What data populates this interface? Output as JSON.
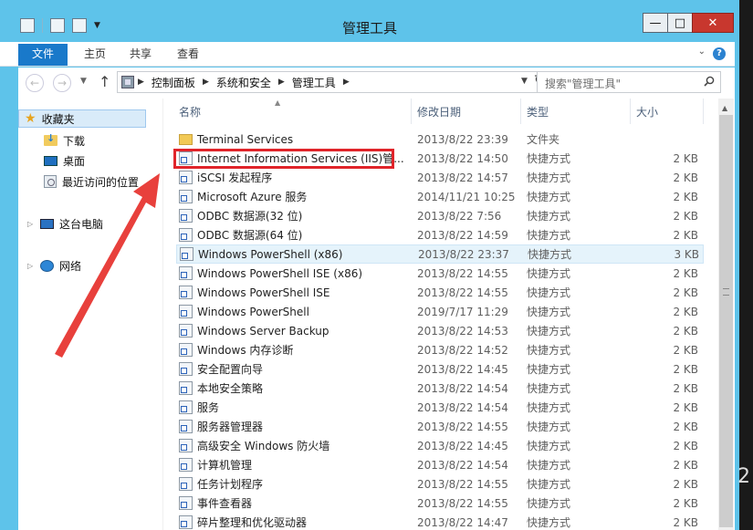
{
  "window": {
    "title": "管理工具",
    "controls": {
      "minimize": "—",
      "maximize": "□",
      "close": "✕"
    }
  },
  "ribbon": {
    "tabs": [
      "文件",
      "主页",
      "共享",
      "查看"
    ],
    "help": "?"
  },
  "navbar": {
    "breadcrumbs": [
      "控制面板",
      "系统和安全",
      "管理工具"
    ],
    "search_placeholder": "搜索\"管理工具\""
  },
  "sidebar": {
    "favorites_label": "收藏夹",
    "favorites": [
      "下载",
      "桌面",
      "最近访问的位置"
    ],
    "this_pc": "这台电脑",
    "network": "网络"
  },
  "filelist": {
    "columns": {
      "name": "名称",
      "date": "修改日期",
      "type": "类型",
      "size": "大小"
    },
    "rows": [
      {
        "name": "Terminal Services",
        "date": "2013/8/22 23:39",
        "type": "文件夹",
        "size": "",
        "kind": "folder"
      },
      {
        "name": "Internet Information Services (IIS)管...",
        "date": "2013/8/22 14:50",
        "type": "快捷方式",
        "size": "2 KB",
        "kind": "shortcut"
      },
      {
        "name": "iSCSI 发起程序",
        "date": "2013/8/22 14:57",
        "type": "快捷方式",
        "size": "2 KB",
        "kind": "shortcut"
      },
      {
        "name": "Microsoft Azure 服务",
        "date": "2014/11/21 10:25",
        "type": "快捷方式",
        "size": "2 KB",
        "kind": "shortcut"
      },
      {
        "name": "ODBC 数据源(32 位)",
        "date": "2013/8/22 7:56",
        "type": "快捷方式",
        "size": "2 KB",
        "kind": "shortcut"
      },
      {
        "name": "ODBC 数据源(64 位)",
        "date": "2013/8/22 14:59",
        "type": "快捷方式",
        "size": "2 KB",
        "kind": "shortcut"
      },
      {
        "name": "Windows PowerShell (x86)",
        "date": "2013/8/22 23:37",
        "type": "快捷方式",
        "size": "3 KB",
        "kind": "shortcut"
      },
      {
        "name": "Windows PowerShell ISE (x86)",
        "date": "2013/8/22 14:55",
        "type": "快捷方式",
        "size": "2 KB",
        "kind": "shortcut"
      },
      {
        "name": "Windows PowerShell ISE",
        "date": "2013/8/22 14:55",
        "type": "快捷方式",
        "size": "2 KB",
        "kind": "shortcut"
      },
      {
        "name": "Windows PowerShell",
        "date": "2019/7/17 11:29",
        "type": "快捷方式",
        "size": "2 KB",
        "kind": "shortcut"
      },
      {
        "name": "Windows Server Backup",
        "date": "2013/8/22 14:53",
        "type": "快捷方式",
        "size": "2 KB",
        "kind": "shortcut"
      },
      {
        "name": "Windows 内存诊断",
        "date": "2013/8/22 14:52",
        "type": "快捷方式",
        "size": "2 KB",
        "kind": "shortcut"
      },
      {
        "name": "安全配置向导",
        "date": "2013/8/22 14:45",
        "type": "快捷方式",
        "size": "2 KB",
        "kind": "shortcut"
      },
      {
        "name": "本地安全策略",
        "date": "2013/8/22 14:54",
        "type": "快捷方式",
        "size": "2 KB",
        "kind": "shortcut"
      },
      {
        "name": "服务",
        "date": "2013/8/22 14:54",
        "type": "快捷方式",
        "size": "2 KB",
        "kind": "shortcut"
      },
      {
        "name": "服务器管理器",
        "date": "2013/8/22 14:55",
        "type": "快捷方式",
        "size": "2 KB",
        "kind": "shortcut"
      },
      {
        "name": "高级安全 Windows 防火墙",
        "date": "2013/8/22 14:45",
        "type": "快捷方式",
        "size": "2 KB",
        "kind": "shortcut"
      },
      {
        "name": "计算机管理",
        "date": "2013/8/22 14:54",
        "type": "快捷方式",
        "size": "2 KB",
        "kind": "shortcut"
      },
      {
        "name": "任务计划程序",
        "date": "2013/8/22 14:55",
        "type": "快捷方式",
        "size": "2 KB",
        "kind": "shortcut"
      },
      {
        "name": "事件查看器",
        "date": "2013/8/22 14:55",
        "type": "快捷方式",
        "size": "2 KB",
        "kind": "shortcut"
      },
      {
        "name": "碎片整理和优化驱动器",
        "date": "2013/8/22 14:47",
        "type": "快捷方式",
        "size": "2 KB",
        "kind": "shortcut"
      }
    ],
    "selected_index": 6,
    "highlighted_index": 1
  },
  "annotation": {
    "color": "#e8403c"
  },
  "edge_text": "2",
  "colors": {
    "frame": "#5ec3ea",
    "file_tab": "#1979ca",
    "selection": "#e5f3fb",
    "highlight_box": "#e0242a"
  }
}
